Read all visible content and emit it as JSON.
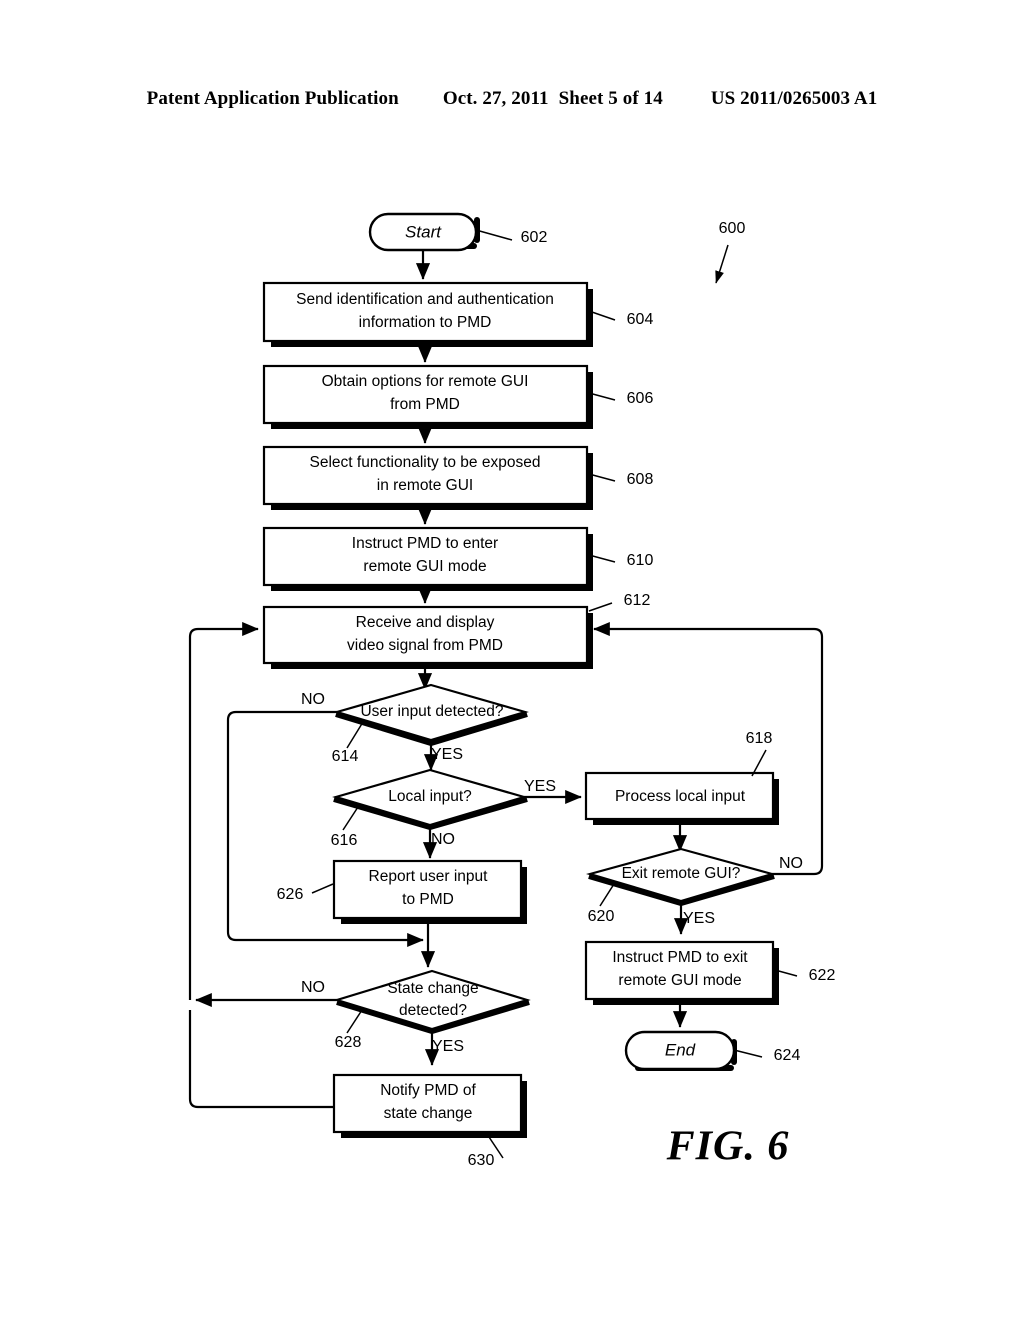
{
  "header": {
    "publication": "Patent Application Publication",
    "date": "Oct. 27, 2011",
    "sheet": "Sheet 5 of 14",
    "doc_number": "US 2011/0265003 A1"
  },
  "figure": {
    "label": "FIG. 6",
    "diagram_ref": "600"
  },
  "nodes": {
    "start": {
      "label": "Start",
      "ref": "602"
    },
    "send_auth": {
      "line1": "Send identification and authentication",
      "line2": "information to PMD",
      "ref": "604"
    },
    "obtain_options": {
      "line1": "Obtain options for remote GUI",
      "line2": "from PMD",
      "ref": "606"
    },
    "select_functionality": {
      "line1": "Select functionality to be exposed",
      "line2": "in remote GUI",
      "ref": "608"
    },
    "instruct_enter": {
      "line1": "Instruct PMD to enter",
      "line2": "remote GUI mode",
      "ref": "610"
    },
    "receive_display": {
      "line1": "Receive and display",
      "line2": "video signal from PMD",
      "ref": "612"
    },
    "user_input_detected": {
      "label": "User input detected?",
      "ref": "614"
    },
    "local_input": {
      "label": "Local input?",
      "ref": "616"
    },
    "process_local_input": {
      "label": "Process local input",
      "ref": "618"
    },
    "exit_remote_gui": {
      "label": "Exit remote GUI?",
      "ref": "620"
    },
    "instruct_exit": {
      "line1": "Instruct PMD to exit",
      "line2": "remote GUI mode",
      "ref": "622"
    },
    "end": {
      "label": "End",
      "ref": "624"
    },
    "report_user_input": {
      "line1": "Report user input",
      "line2": "to PMD",
      "ref": "626"
    },
    "state_change_detected": {
      "line1": "State change",
      "line2": "detected?",
      "ref": "628"
    },
    "notify_state_change": {
      "line1": "Notify PMD of",
      "line2": "state change",
      "ref": "630"
    }
  },
  "branch_labels": {
    "user_input_no": "NO",
    "user_input_yes": "YES",
    "local_input_yes": "YES",
    "local_input_no": "NO",
    "exit_gui_no": "NO",
    "exit_gui_yes": "YES",
    "state_change_no": "NO",
    "state_change_yes": "YES"
  },
  "colors": {
    "ink": "#000000",
    "paper": "#ffffff"
  }
}
